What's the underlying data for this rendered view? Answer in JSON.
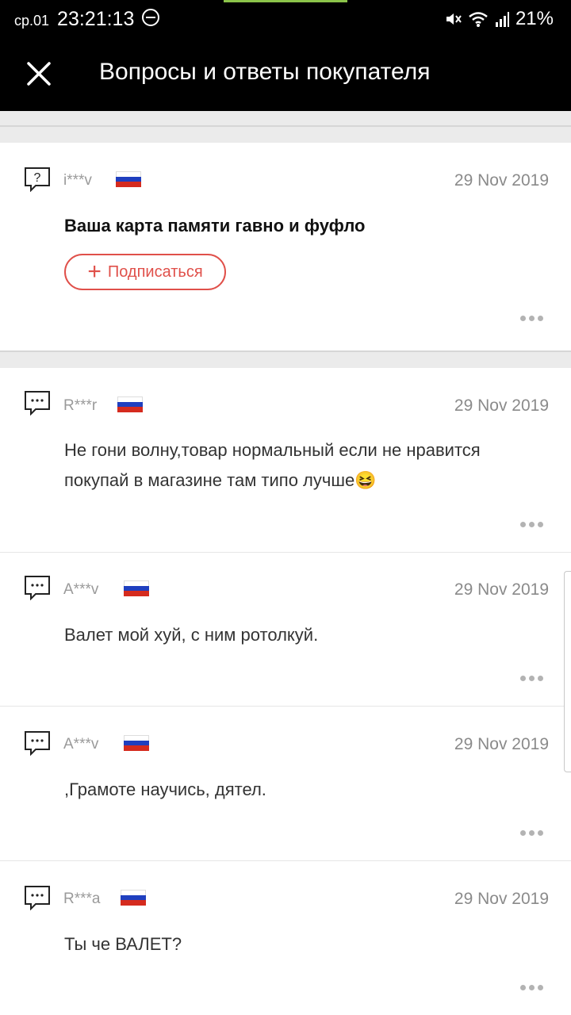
{
  "status_bar": {
    "day": "ср.01",
    "time": "23:21:13",
    "battery": "21%",
    "icons": [
      "dnd-icon",
      "mute-icon",
      "wifi-icon",
      "signal-icon"
    ]
  },
  "header": {
    "title": "Вопросы и ответы покупателя",
    "close_icon": "close-icon"
  },
  "question": {
    "user": "i***v",
    "flag": "russia",
    "date": "29 Nov 2019",
    "text": "Ваша карта памяти гавно и фуфло",
    "subscribe_label": "Подписаться"
  },
  "answers": [
    {
      "user": "R***r",
      "flag": "russia",
      "date": "29 Nov 2019",
      "text": "Не гони волну,товар нормальный если не нравится покупай в магазине там типо лучше😆"
    },
    {
      "user": "A***v",
      "flag": "russia",
      "date": "29 Nov 2019",
      "text": "Валет мой хуй, с ним ротолкуй."
    },
    {
      "user": "A***v",
      "flag": "russia",
      "date": "29 Nov 2019",
      "text": ",Грамоте научись, дятел."
    },
    {
      "user": "R***a",
      "flag": "russia",
      "date": "29 Nov 2019",
      "text": "Ты че ВАЛЕТ?"
    }
  ],
  "colors": {
    "accent": "#e0504a",
    "header_bg": "#000000",
    "flag_white": "#ffffff",
    "flag_blue": "#1f3fbf",
    "flag_red": "#d52b1e"
  }
}
